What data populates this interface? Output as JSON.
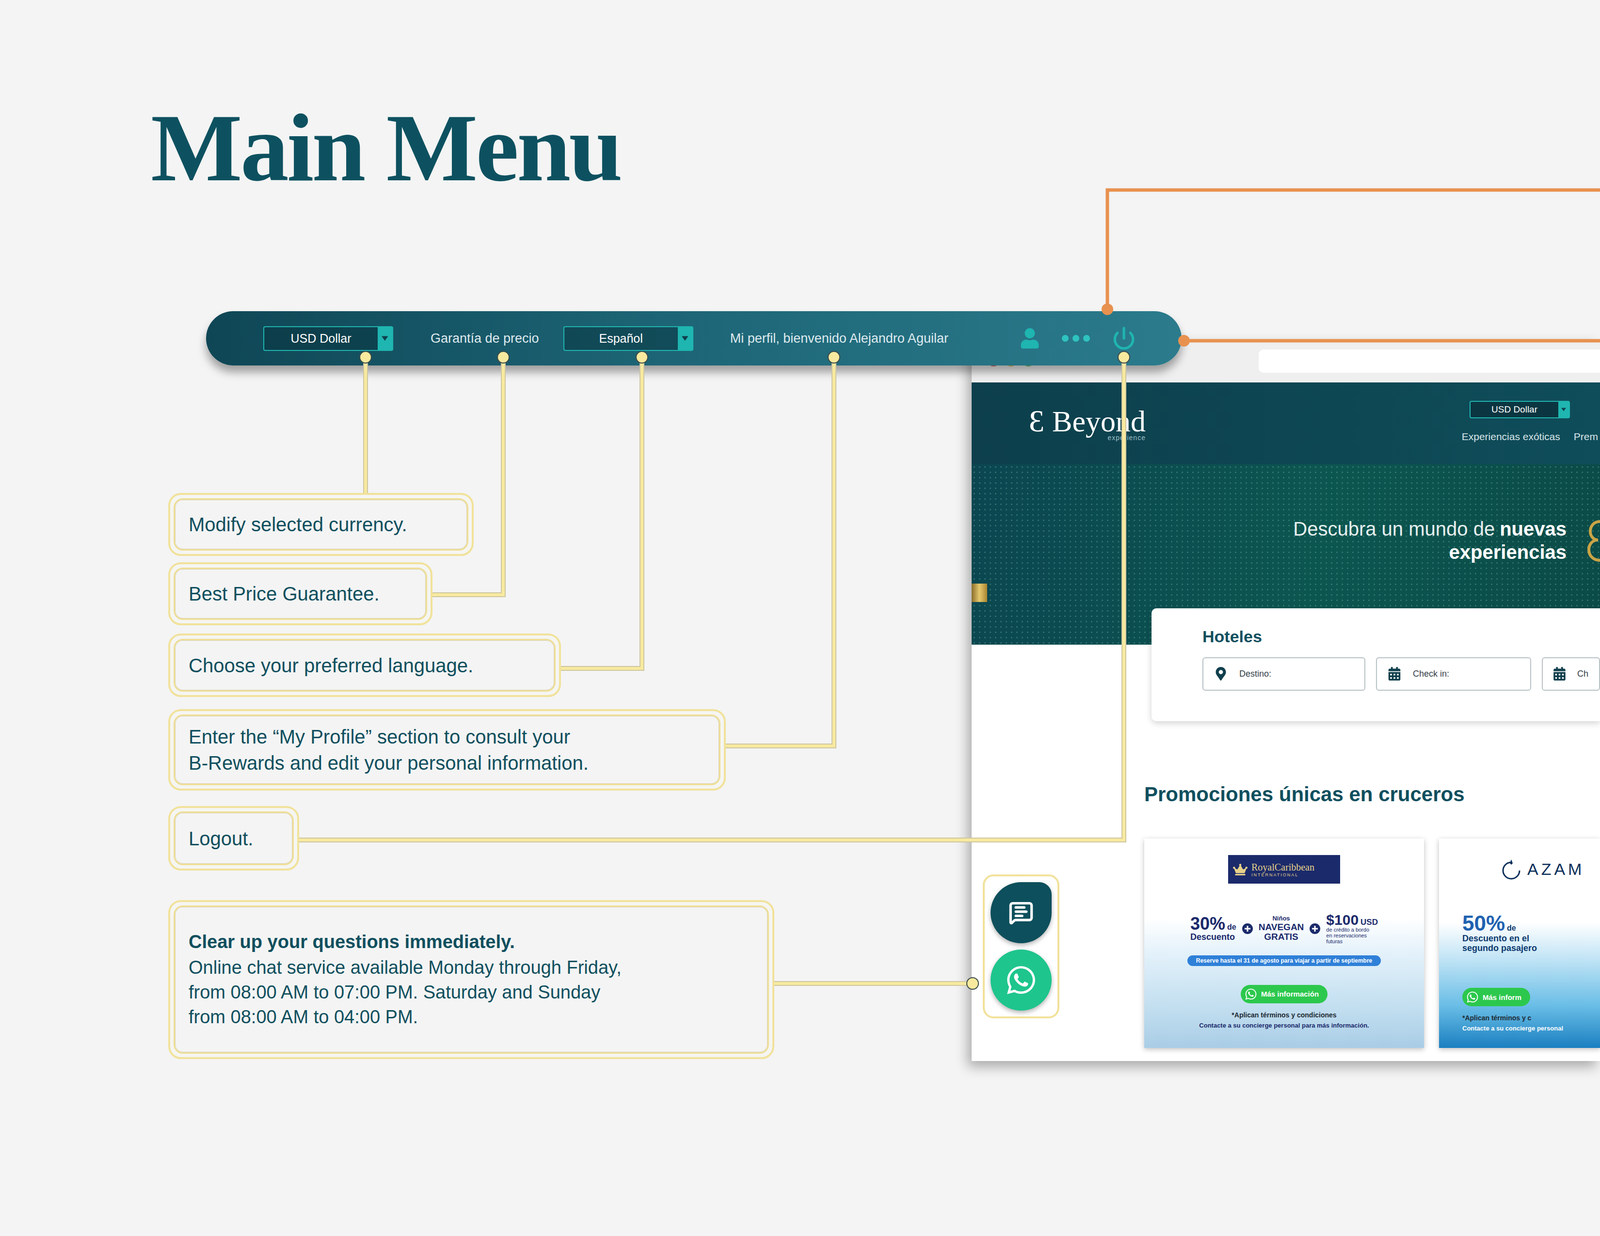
{
  "page": {
    "title": "Main Menu"
  },
  "toolbar": {
    "currency": "USD Dollar",
    "price_guarantee": "Garantía de precio",
    "language": "Español",
    "profile": "Mi perfil, bienvenido Alejandro Aguilar"
  },
  "callouts": [
    {
      "kind": "plain",
      "lines": [
        "Modify selected currency."
      ]
    },
    {
      "kind": "plain",
      "lines": [
        "Best Price Guarantee."
      ]
    },
    {
      "kind": "plain",
      "lines": [
        "Choose your preferred language."
      ]
    },
    {
      "kind": "plain",
      "lines": [
        "Enter the “My Profile” section to consult your",
        "B-Rewards and edit your personal information."
      ]
    },
    {
      "kind": "plain",
      "lines": [
        "Logout."
      ]
    },
    {
      "kind": "detail",
      "title": "Clear up your questions immediately.",
      "lines": [
        "Online chat service available Monday through Friday,",
        "from 08:00 AM to 07:00 PM. Saturday and Sunday",
        "from 08:00 AM to 04:00 PM."
      ]
    }
  ],
  "browser": {
    "logo": {
      "mark": "Ɛ",
      "name": "Beyond",
      "tagline": "experience"
    },
    "currency": "USD Dollar",
    "nav": [
      "Experiencias exóticas",
      "Prem"
    ],
    "hero": {
      "light": "Descubra un mundo de",
      "bold": "nuevas",
      "line2": "experiencias"
    },
    "search": {
      "title": "Hoteles",
      "fields": [
        {
          "kind": "location",
          "placeholder": "Destino:"
        },
        {
          "kind": "date",
          "placeholder": "Check in:"
        },
        {
          "kind": "date",
          "placeholder": "Ch"
        }
      ]
    },
    "promotions": {
      "title": "Promociones únicas en cruceros",
      "cards": [
        {
          "kind": "royal",
          "logo": "RoyalCaribbean",
          "logo_sub": "INTERNATIONAL",
          "offers": [
            {
              "kind": "percent",
              "big": "30%",
              "small": "de",
              "lines": [
                "Descuento"
              ]
            },
            {
              "kind": "stack",
              "small": "Niños",
              "lines": [
                "NAVEGAN",
                "GRATIS"
              ]
            },
            {
              "kind": "credit",
              "big": "$100",
              "small": "USD",
              "lines": [
                "de crédito a bordo",
                "en reservaciones",
                "futuras"
              ]
            }
          ],
          "note": "Reserve hasta el 31 de agosto para viajar a partir de septiembre",
          "button": "Más información",
          "terms": "*Aplican términos y condiciones",
          "contact": "Contacte a su concierge personal para más información."
        },
        {
          "kind": "azam",
          "logo": "AZAM",
          "offers": [
            {
              "kind": "percent",
              "big": "50%",
              "small": "de",
              "lines": [
                "Descuento en el",
                "segundo pasajero"
              ]
            }
          ],
          "button": "Más inform",
          "terms": "*Aplican términos y c",
          "contact": "Contacte a su concierge personal"
        }
      ]
    }
  },
  "chat": {
    "buttons": [
      {
        "kind": "chat"
      },
      {
        "kind": "whatsapp"
      }
    ]
  }
}
